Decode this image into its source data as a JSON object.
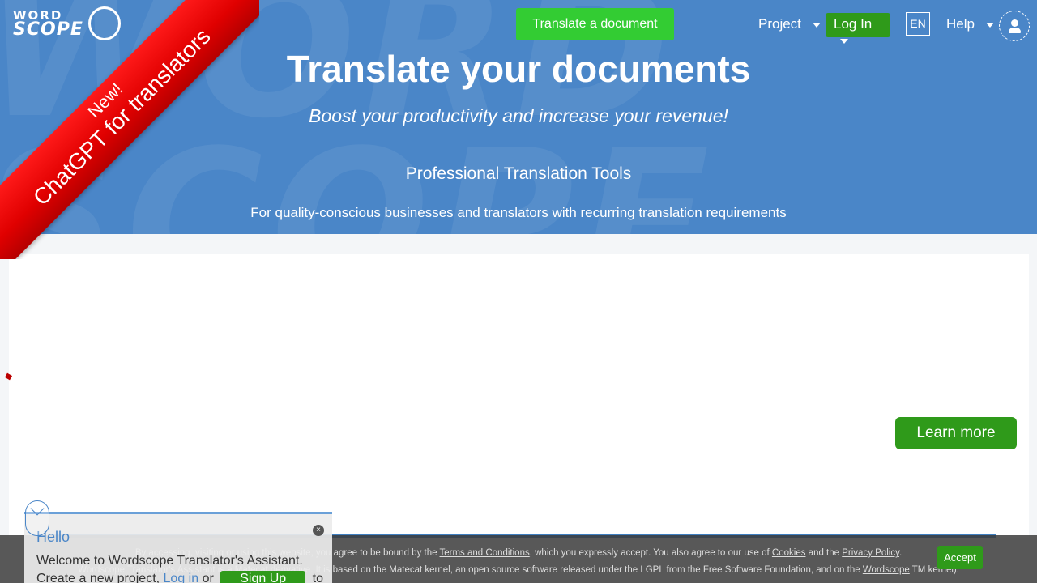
{
  "header": {
    "logo_line1": "WORD",
    "logo_line2": "SCOPE",
    "translate_button": "Translate a document",
    "nav": {
      "project": "Project",
      "login": "Log In",
      "language": "EN",
      "help": "Help"
    }
  },
  "ribbon": {
    "line1": "New!",
    "line2": "ChatGPT for translators"
  },
  "hero": {
    "title": "Translate your documents",
    "subtitle": "Boost your productivity and increase your revenue!",
    "tools": "Professional Translation Tools",
    "description": "For quality-conscious businesses and translators with recurring translation requirements"
  },
  "content": {
    "learn_more": "Learn more"
  },
  "cookie": {
    "line1_a": "By accessing, visiting or using this website, you agree to be bound by the ",
    "terms": "Terms and Conditions",
    "line1_b": ", which you expressly accept. You also agree to our use of ",
    "cookies": "Cookies",
    "line1_c": " and the ",
    "privacy": "Privacy Policy",
    "line1_d": ".",
    "line2_a": "Wordscope Translator's Assistant is a Matecat derivative. It is based on the Matecat kernel, an open source software released under the LGPL from the Free Software Foundation, and on the ",
    "wordscope": "Wordscope",
    "line2_b": " TM kernel).",
    "accept": "Accept"
  },
  "assistant": {
    "hello": "Hello",
    "welcome": "Welcome to Wordscope Translator's Assistant.",
    "create_a": "Create a new project, ",
    "login": "Log in",
    "or": " or ",
    "signup": "Sign Up",
    "to": " to",
    "close": "×"
  },
  "colors": {
    "hero_blue": "#4a86c8",
    "green": "#2f9a1a",
    "bright_green": "#33cc33",
    "ribbon_red": "#e00000"
  }
}
